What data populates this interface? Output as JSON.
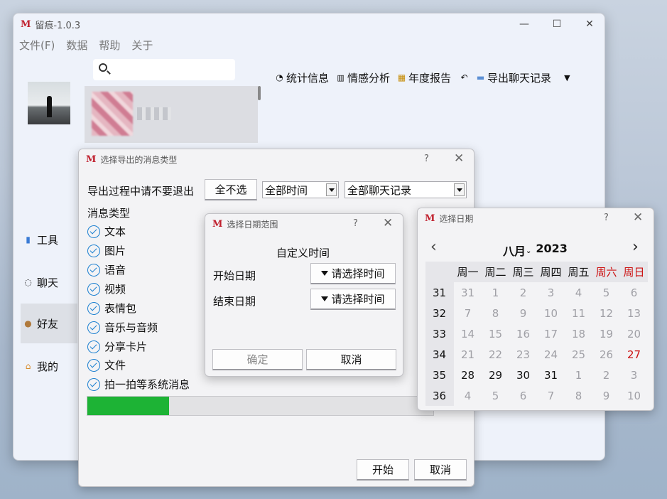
{
  "main": {
    "title": "留痕-1.0.3",
    "logo": "M",
    "menu": [
      "文件(F)",
      "数据",
      "帮助",
      "关于"
    ],
    "toolbar": {
      "stats": "统计信息",
      "sentiment": "情感分析",
      "annual": "年度报告",
      "export": "导出聊天记录"
    },
    "nav": {
      "tools": "工具",
      "chat": "聊天",
      "friends": "好友",
      "me": "我的"
    }
  },
  "export_dialog": {
    "title": "选择导出的消息类型",
    "warning": "导出过程中请不要退出",
    "deselect_all": "全不选",
    "time_range": "全部时间",
    "record_scope": "全部聊天记录",
    "types_label": "消息类型",
    "types": [
      "文本",
      "图片",
      "语音",
      "视频",
      "表情包",
      "音乐与音频",
      "分享卡片",
      "文件",
      "拍一拍等系统消息"
    ],
    "progress": 0.236,
    "start": "开始",
    "cancel": "取消"
  },
  "range_dialog": {
    "title": "选择日期范围",
    "heading": "自定义时间",
    "start_label": "开始日期",
    "end_label": "结束日期",
    "pick": "请选择时间",
    "ok": "确定",
    "cancel": "取消"
  },
  "calendar": {
    "title": "选择日期",
    "month": "八月",
    "year": "2023",
    "weekdays": [
      "周一",
      "周二",
      "周三",
      "周四",
      "周五",
      "周六",
      "周日"
    ],
    "weeks": [
      "31",
      "32",
      "33",
      "34",
      "35",
      "36"
    ],
    "days": [
      [
        "31",
        "1",
        "2",
        "3",
        "4",
        "5",
        "6"
      ],
      [
        "7",
        "8",
        "9",
        "10",
        "11",
        "12",
        "13"
      ],
      [
        "14",
        "15",
        "16",
        "17",
        "18",
        "19",
        "20"
      ],
      [
        "21",
        "22",
        "23",
        "24",
        "25",
        "26",
        "27"
      ],
      [
        "28",
        "29",
        "30",
        "31",
        "1",
        "2",
        "3"
      ],
      [
        "4",
        "5",
        "6",
        "7",
        "8",
        "9",
        "10"
      ]
    ],
    "current_month": [
      [
        false,
        true,
        true,
        true,
        true,
        true,
        true
      ],
      [
        true,
        true,
        true,
        true,
        true,
        true,
        true
      ],
      [
        true,
        true,
        true,
        true,
        true,
        true,
        true
      ],
      [
        true,
        true,
        true,
        true,
        true,
        true,
        true
      ],
      [
        true,
        true,
        true,
        true,
        false,
        false,
        false
      ],
      [
        false,
        false,
        false,
        false,
        false,
        false,
        false
      ]
    ],
    "today": "27",
    "colors": {
      "weekend": "#cc1111",
      "muted": "#a0a0a6",
      "today": "#cc1111"
    }
  },
  "colors": {
    "progress": "#1db335",
    "accent": "#1a7fd0",
    "logo": "#c0202e"
  }
}
